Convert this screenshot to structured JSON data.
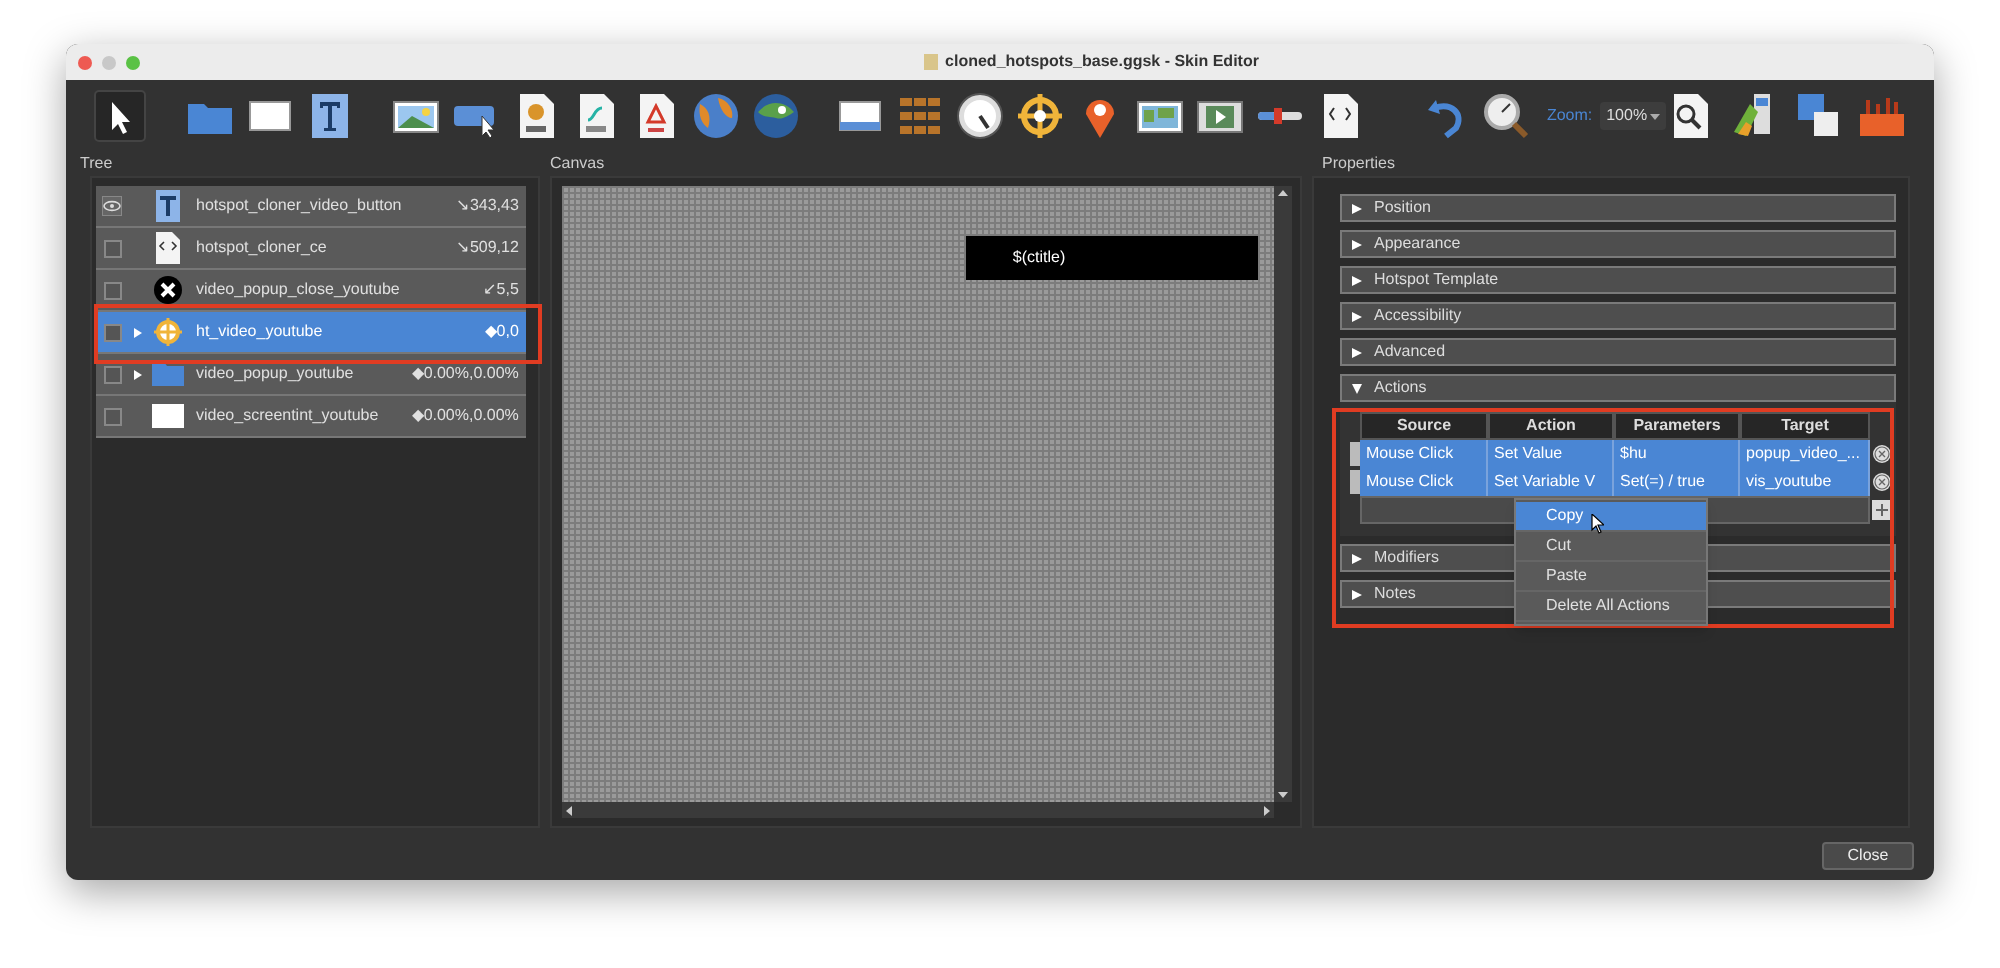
{
  "window": {
    "title": "cloned_hotspots_base.ggsk - Skin Editor"
  },
  "toolbar": {
    "zoom_label": "Zoom:",
    "zoom_value": "100%"
  },
  "panels": {
    "tree": "Tree",
    "canvas": "Canvas",
    "properties": "Properties"
  },
  "tree": [
    {
      "kind": "text",
      "name": "hotspot_cloner_video_button",
      "value": "↘343,43",
      "visible": true,
      "selected": false,
      "has_children": false
    },
    {
      "kind": "code",
      "name": "hotspot_cloner_ce",
      "value": "↘509,12",
      "visible": false,
      "selected": false,
      "has_children": false
    },
    {
      "kind": "close",
      "name": "video_popup_close_youtube",
      "value": "↙5,5",
      "visible": false,
      "selected": false,
      "has_children": false
    },
    {
      "kind": "hotspot",
      "name": "ht_video_youtube",
      "value": "◆0,0",
      "visible": false,
      "selected": true,
      "has_children": true
    },
    {
      "kind": "folder",
      "name": "video_popup_youtube",
      "value": "◆0.00%,0.00%",
      "visible": false,
      "selected": false,
      "has_children": true
    },
    {
      "kind": "rectangle",
      "name": "video_screentint_youtube",
      "value": "◆0.00%,0.00%",
      "visible": false,
      "selected": false,
      "has_children": false
    }
  ],
  "canvas": {
    "text_element": "$(ctitle)"
  },
  "sections": [
    {
      "label": "Position",
      "expanded": false
    },
    {
      "label": "Appearance",
      "expanded": false
    },
    {
      "label": "Hotspot Template",
      "expanded": false
    },
    {
      "label": "Accessibility",
      "expanded": false
    },
    {
      "label": "Advanced",
      "expanded": false
    },
    {
      "label": "Actions",
      "expanded": true
    },
    {
      "label": "Modifiers",
      "expanded": false
    },
    {
      "label": "Notes",
      "expanded": false
    }
  ],
  "actions_table": {
    "columns": [
      "Source",
      "Action",
      "Parameters",
      "Target"
    ],
    "rows": [
      {
        "cells": [
          "Mouse Click",
          "Set Value",
          "$hu",
          "popup_video_..."
        ],
        "selected": true
      },
      {
        "cells": [
          "Mouse Click",
          "Set Variable V",
          "Set(=) / true",
          "vis_youtube"
        ],
        "selected": true
      }
    ]
  },
  "context_menu": [
    {
      "label": "Copy",
      "selected": true
    },
    {
      "label": "Cut",
      "selected": false
    },
    {
      "label": "Paste",
      "selected": false
    },
    {
      "label": "Delete All Actions",
      "selected": false
    }
  ],
  "buttons": {
    "close": "Close"
  }
}
